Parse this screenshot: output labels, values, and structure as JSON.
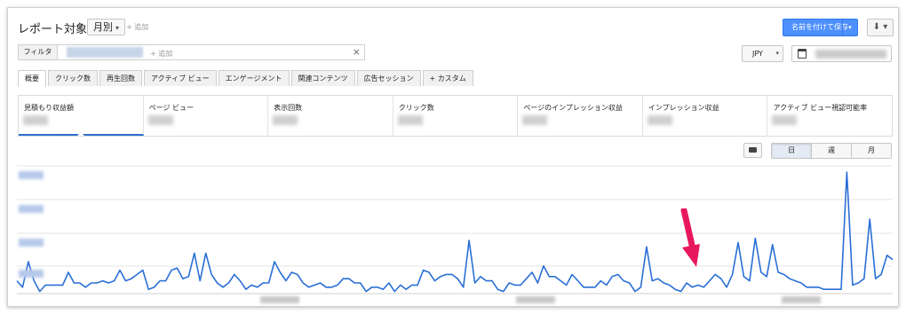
{
  "header": {
    "title": "レポート対象",
    "title_chevron": "›",
    "period": "月別",
    "period_caret": "▾",
    "add_label": "+ 追加"
  },
  "toolbar": {
    "save_label": "名前を付けて保存",
    "save_caret": "▾",
    "download_label": "⬇ ▾"
  },
  "filter": {
    "label": "フィルタ",
    "add_label": "+ 追加",
    "clear_label": "×"
  },
  "currency": {
    "value": "JPY",
    "caret": "▾"
  },
  "tabs": [
    {
      "label": "概要",
      "active": true
    },
    {
      "label": "クリック数"
    },
    {
      "label": "再生回数"
    },
    {
      "label": "アクティブ ビュー"
    },
    {
      "label": "エンゲージメント"
    },
    {
      "label": "関連コンテンツ"
    },
    {
      "label": "広告セッション"
    },
    {
      "label": "+ カスタム"
    }
  ],
  "metrics": [
    {
      "label": "見積もり収益額",
      "selected": true
    },
    {
      "label": "ページ ビュー"
    },
    {
      "label": "表示回数"
    },
    {
      "label": "クリック数"
    },
    {
      "label": "ページのインプレッション収益"
    },
    {
      "label": "インプレッション収益"
    },
    {
      "label": "アクティブ ビュー視認可能率"
    }
  ],
  "granularity": [
    {
      "label": "日",
      "selected": true
    },
    {
      "label": "週"
    },
    {
      "label": "月"
    }
  ],
  "colors": {
    "line": "#2a6fd6",
    "accent": "#4d90fe",
    "arrow": "#e8185f"
  },
  "chart_data": {
    "type": "line",
    "grid": "horizontal",
    "legend": "none",
    "series": [
      {
        "values": [
          6,
          3,
          15,
          6,
          1,
          4,
          4,
          4,
          4,
          10,
          5,
          5,
          3,
          5,
          5,
          6,
          5,
          6,
          11,
          6,
          7,
          9,
          11,
          2,
          3,
          6,
          6,
          11,
          12,
          7,
          8,
          19,
          6,
          19,
          9,
          5,
          3,
          5,
          9,
          6,
          2,
          4,
          3,
          5,
          5,
          15,
          10,
          6,
          10,
          9,
          5,
          3,
          4,
          5,
          3,
          3,
          4,
          7,
          7,
          5,
          5,
          1,
          3,
          3,
          2,
          5,
          1,
          4,
          2,
          4,
          4,
          11,
          10,
          6,
          8,
          9,
          9,
          7,
          3,
          25,
          5,
          8,
          6,
          6,
          2,
          1,
          5,
          4,
          4,
          7,
          10,
          5,
          13,
          8,
          8,
          6,
          4,
          9,
          6,
          3,
          3,
          3,
          6,
          4,
          8,
          9,
          6,
          5,
          1,
          3,
          22,
          6,
          7,
          5,
          4,
          2,
          1,
          5,
          3,
          4,
          3,
          6,
          9,
          7,
          3,
          9,
          24,
          8,
          6,
          26,
          10,
          8,
          23,
          10,
          9,
          7,
          6,
          5,
          3,
          3,
          3,
          2,
          2,
          2,
          2,
          57,
          4,
          5,
          7,
          35,
          7,
          9,
          18,
          16
        ]
      }
    ]
  }
}
